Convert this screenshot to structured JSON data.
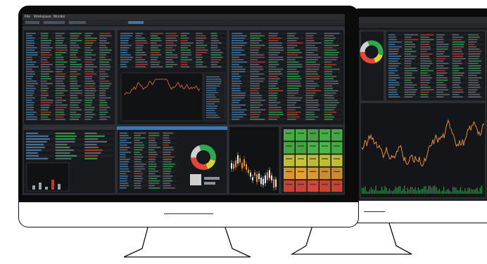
{
  "app": {
    "tabs": [
      "File",
      "Workspace",
      "Monitor"
    ]
  },
  "colors": {
    "bezel": "#0b0b0b",
    "screen_bg": "#1f2125",
    "panel_bg": "#17191c",
    "positive": "#2fa84f",
    "negative": "#c0392b",
    "chart_line": "#d0553a",
    "chart_line_alt": "#e08a3c",
    "accent_blue": "#3a79b8",
    "heatmap_green": "#4cb84a",
    "heatmap_yellow": "#d6d336",
    "heatmap_red": "#e0493a"
  },
  "donut_segments": [
    {
      "color": "#2fa84f",
      "share": 0.35
    },
    {
      "color": "#d6d336",
      "share": 0.15
    },
    {
      "color": "#e0493a",
      "share": 0.3
    },
    {
      "color": "#cfcfcf",
      "share": 0.2
    }
  ]
}
